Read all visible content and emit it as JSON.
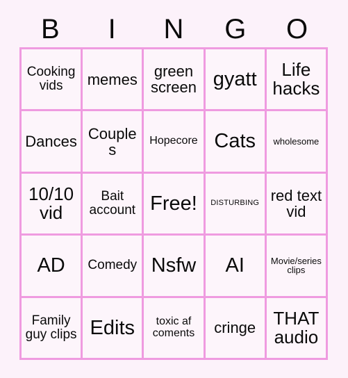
{
  "card": {
    "header_letters": [
      "B",
      "I",
      "N",
      "G",
      "O"
    ],
    "colors": {
      "page_background": "#fcf2fa",
      "grid_line": "#ef9be0",
      "cell_background": "#fdf5fb",
      "text": "#0a0a0a"
    },
    "grid": {
      "rows": 5,
      "columns": 5,
      "free_space_index": 12
    },
    "cells": [
      {
        "text": "Cooking vids",
        "size": "m"
      },
      {
        "text": "memes",
        "size": "l"
      },
      {
        "text": "green screen",
        "size": "l"
      },
      {
        "text": "gyatt",
        "size": "xxl"
      },
      {
        "text": "Life hacks",
        "size": "xl"
      },
      {
        "text": "Dances",
        "size": "l"
      },
      {
        "text": "Couples",
        "size": "l"
      },
      {
        "text": "Hopecore",
        "size": "s"
      },
      {
        "text": "Cats",
        "size": "xxl"
      },
      {
        "text": "wholesome",
        "size": "xs"
      },
      {
        "text": "10/10 vid",
        "size": "xl"
      },
      {
        "text": "Bait account",
        "size": "m"
      },
      {
        "text": "Free!",
        "size": "xxl"
      },
      {
        "text": "DISTURBING",
        "size": "xxs"
      },
      {
        "text": "red text vid",
        "size": "l"
      },
      {
        "text": "AD",
        "size": "xxl"
      },
      {
        "text": "Comedy",
        "size": "m"
      },
      {
        "text": "Nsfw",
        "size": "xxl"
      },
      {
        "text": "AI",
        "size": "xxl"
      },
      {
        "text": "Movie/series clips",
        "size": "xs"
      },
      {
        "text": "Family guy clips",
        "size": "m"
      },
      {
        "text": "Edits",
        "size": "xxl"
      },
      {
        "text": "toxic af coments",
        "size": "s"
      },
      {
        "text": "cringe",
        "size": "l"
      },
      {
        "text": "THAT audio",
        "size": "xl"
      }
    ]
  }
}
